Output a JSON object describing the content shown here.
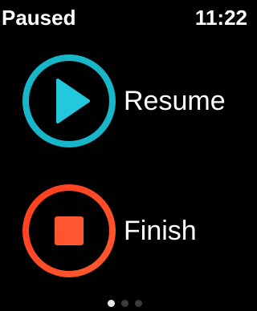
{
  "status": {
    "title": "Paused",
    "time": "11:22"
  },
  "actions": [
    {
      "label": "Resume",
      "icon": "play-icon",
      "color": "#17b6c8"
    },
    {
      "label": "Finish",
      "icon": "stop-icon",
      "color": "#ff4a2a"
    }
  ],
  "pagination": {
    "pages": 3,
    "active_index": 0
  }
}
